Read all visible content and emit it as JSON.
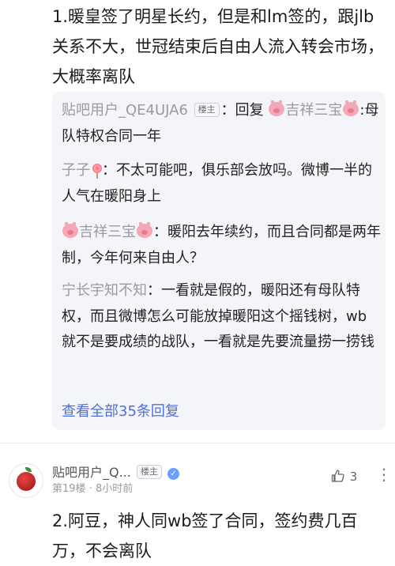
{
  "post": {
    "text": "1.暖皇签了明星长约，但是和lm签的，跟jlb关系不大，世冠结束后自由人流入转会市场，大概率离队"
  },
  "replies": [
    {
      "user": "贴吧用户_QE4UJA6",
      "badge": "楼主",
      "mid": "：回复",
      "to_user": "吉祥三宝",
      "text": ":母队特权合同一年"
    },
    {
      "user": "子子",
      "text": "：不太可能吧，俱乐部会放吗。微博一半的人气在暖阳身上"
    },
    {
      "user": "吉祥三宝",
      "text": "：暖阳去年续约，而且合同都是两年制，今年何来自由人？"
    },
    {
      "user": "宁长宇知不知",
      "text": "：一看就是假的，暖阳还有母队特权，而且微博怎么可能放掉暖阳这个摇钱树，wb就不是要成绩的战队，一看就是先要流量捞一捞钱"
    }
  ],
  "view_all": "查看全部35条回复",
  "comment": {
    "user": "贴吧用户_Q...",
    "badge": "楼主",
    "floor": "第19楼",
    "dot": "·",
    "time": "8小时前",
    "likes": "3",
    "more": "⋮",
    "text": "2.阿豆，神人同wb签了合同，签约费几百万，不会离队"
  },
  "icons": {
    "pig": "pig-emoji-icon",
    "lollipop": "lollipop-emoji-icon",
    "verified": "verified-badge-icon",
    "like": "thumbs-up-icon",
    "more": "more-vertical-icon"
  },
  "colors": {
    "link": "#4f6fd8",
    "username": "#9a9aa5",
    "reply_bg": "#f4f5f8"
  }
}
